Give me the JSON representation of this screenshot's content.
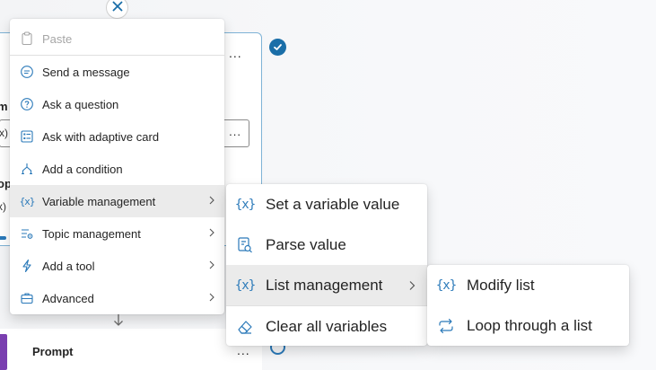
{
  "canvas": {
    "card_field_chip": "x)",
    "card_frag_m": "m",
    "card_frag_p": "op",
    "card_frag_x": "x)",
    "prompt_title": "Prompt",
    "more_label": "..."
  },
  "main_menu": {
    "items": [
      {
        "label": "Paste",
        "icon": "paste-icon",
        "disabled": true
      },
      {
        "label": "Send a message",
        "icon": "chat-icon"
      },
      {
        "label": "Ask a question",
        "icon": "question-icon"
      },
      {
        "label": "Ask with adaptive card",
        "icon": "adaptive-card-icon"
      },
      {
        "label": "Add a condition",
        "icon": "branch-icon"
      },
      {
        "label": "Variable management",
        "icon": "variable-icon",
        "submenu": true,
        "active": true
      },
      {
        "label": "Topic management",
        "icon": "topic-icon",
        "submenu": true
      },
      {
        "label": "Add a tool",
        "icon": "tool-icon",
        "submenu": true
      },
      {
        "label": "Advanced",
        "icon": "briefcase-icon",
        "submenu": true
      }
    ]
  },
  "variable_submenu": {
    "items": [
      {
        "label": "Set a variable value",
        "icon": "variable-icon"
      },
      {
        "label": "Parse value",
        "icon": "parse-icon"
      },
      {
        "label": "List management",
        "icon": "variable-icon",
        "submenu": true,
        "active": true
      },
      {
        "label": "Clear all variables",
        "icon": "eraser-icon"
      }
    ]
  },
  "list_submenu": {
    "items": [
      {
        "label": "Modify list",
        "icon": "variable-icon"
      },
      {
        "label": "Loop through a list",
        "icon": "loop-icon"
      }
    ]
  },
  "colors": {
    "accent": "#2a79b9",
    "active_bg": "#ebebeb",
    "check": "#1a6ea8",
    "prompt_bar": "#7a3fb0"
  }
}
